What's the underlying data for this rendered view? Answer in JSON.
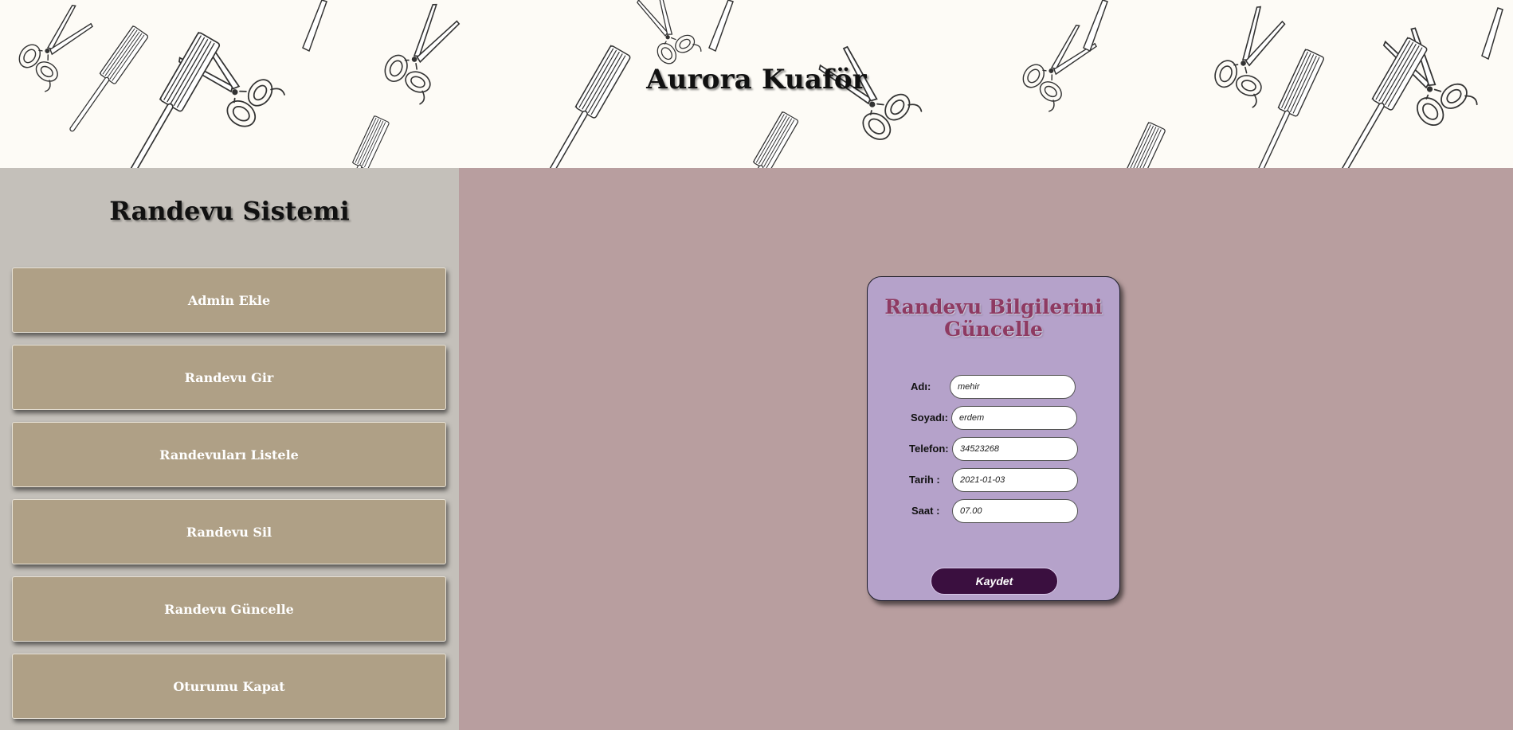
{
  "header": {
    "title": "Aurora Kuaför"
  },
  "sidebar": {
    "title": "Randevu Sistemi",
    "items": [
      {
        "label": "Admin Ekle"
      },
      {
        "label": "Randevu Gir"
      },
      {
        "label": "Randevuları Listele"
      },
      {
        "label": "Randevu Sil"
      },
      {
        "label": "Randevu Güncelle"
      },
      {
        "label": "Oturumu Kapat"
      }
    ]
  },
  "form": {
    "title": "Randevu Bilgilerini Güncelle",
    "fields": [
      {
        "label": "Adı:",
        "value": "mehir"
      },
      {
        "label": "Soyadı:",
        "value": "erdem"
      },
      {
        "label": "Telefon:",
        "value": "34523268"
      },
      {
        "label": "Tarih :",
        "value": "2021-01-03"
      },
      {
        "label": "Saat :",
        "value": "07.00"
      }
    ],
    "submit_label": "Kaydet"
  },
  "colors": {
    "header_bg": "#fdfbf6",
    "sidebar_bg": "#c4c0ba",
    "menu_button_bg": "#afa086",
    "main_bg": "#b89e9f",
    "card_bg": "#b5a2ca",
    "form_title": "#8e3a62",
    "save_button_bg": "#3a0f3f"
  },
  "icons": [
    "scissors-icon",
    "comb-icon"
  ]
}
